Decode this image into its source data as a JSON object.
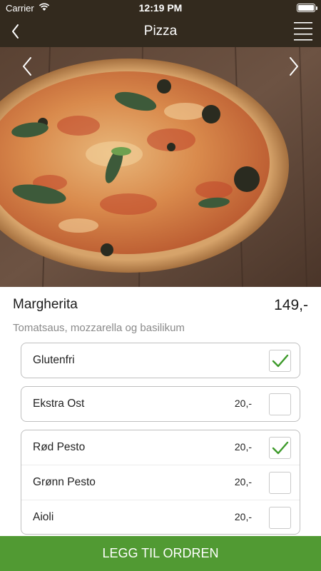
{
  "status_bar": {
    "carrier": "Carrier",
    "time": "12:19 PM"
  },
  "nav": {
    "title": "Pizza"
  },
  "product": {
    "name": "Margherita",
    "price": "149,-",
    "description": "Tomatsaus, mozzarella og basilikum"
  },
  "options": [
    {
      "label": "Glutenfri",
      "price": "",
      "checked": true
    },
    {
      "label": "Ekstra Ost",
      "price": "20,-",
      "checked": false
    },
    {
      "label": "Rød Pesto",
      "price": "20,-",
      "checked": true
    },
    {
      "label": "Grønn Pesto",
      "price": "20,-",
      "checked": false
    },
    {
      "label": "Aioli",
      "price": "20,-",
      "checked": false
    }
  ],
  "order_button": {
    "label": "LEGG TIL ORDREN"
  },
  "colors": {
    "header": "#332a1e",
    "accent": "#519a33",
    "checkmark": "#3d9a2a"
  },
  "icons": [
    "wifi-icon",
    "battery-icon",
    "back-chevron-icon",
    "hamburger-menu-icon",
    "chevron-left-icon",
    "chevron-right-icon",
    "checkmark-icon"
  ]
}
